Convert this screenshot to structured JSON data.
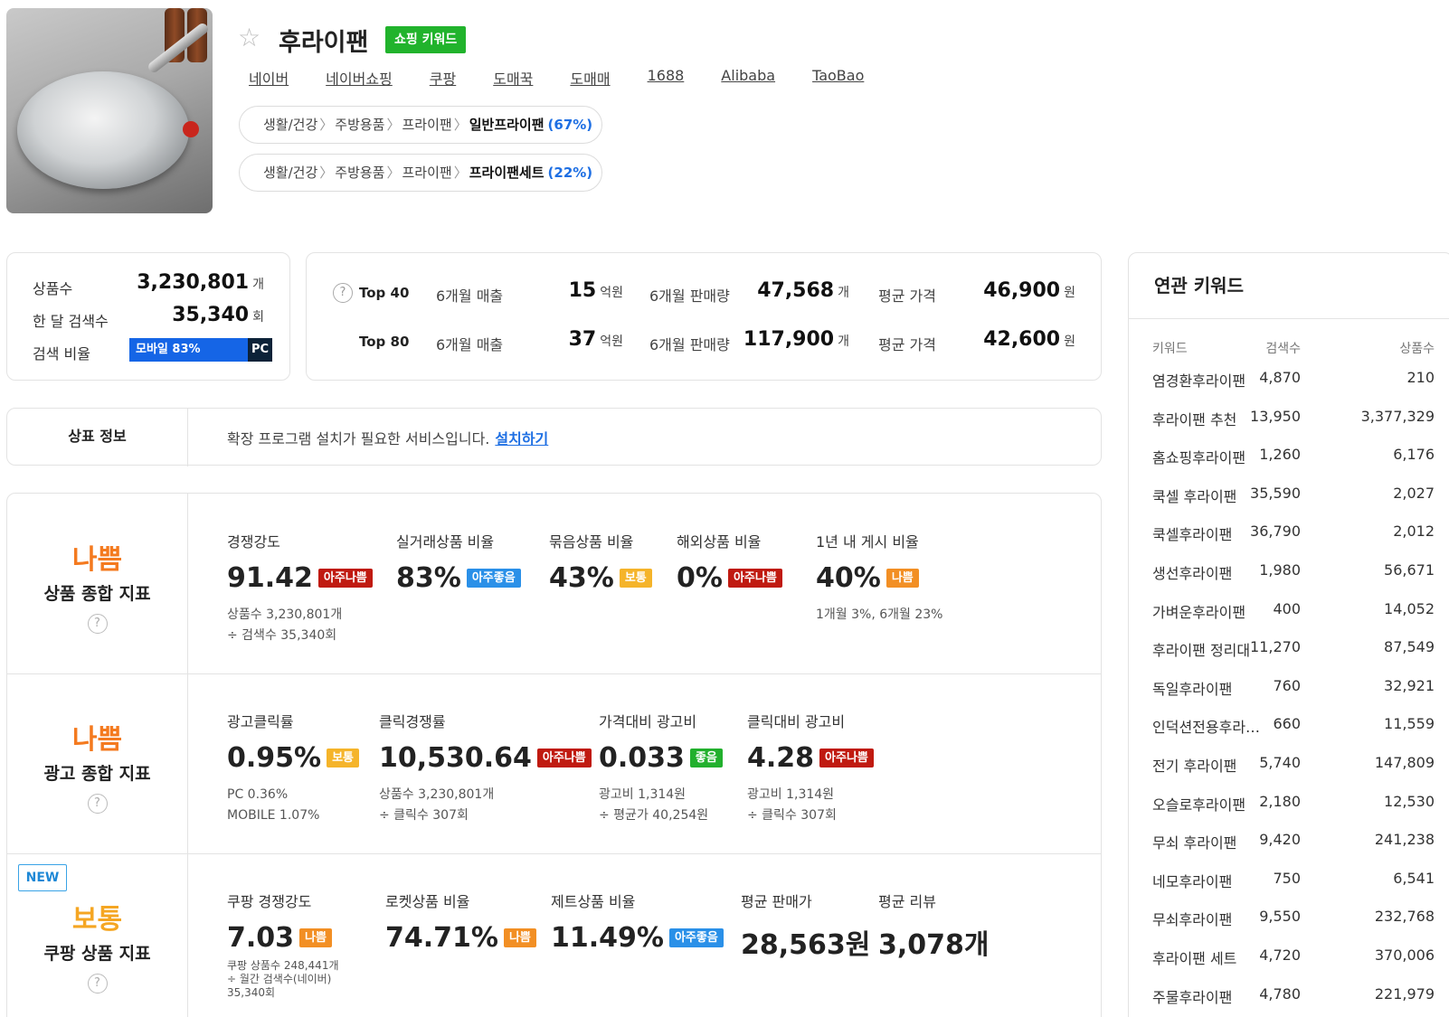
{
  "header": {
    "keyword": "후라이팬",
    "badge": "쇼핑 키워드",
    "links": [
      "네이버",
      "네이버쇼핑",
      "쿠팡",
      "도매꾹",
      "도매매",
      "1688",
      "Alibaba",
      "TaoBao"
    ],
    "categories": [
      {
        "path": [
          "생활/건강",
          "주방용품",
          "프라이팬"
        ],
        "leaf": "일반프라이팬",
        "pct": "(67%)"
      },
      {
        "path": [
          "생활/건강",
          "주방용품",
          "프라이팬"
        ],
        "leaf": "프라이팬세트",
        "pct": "(22%)"
      }
    ]
  },
  "summary": {
    "product_count_label": "상품수",
    "product_count": "3,230,801",
    "product_count_unit": "개",
    "monthly_search_label": "한 달 검색수",
    "monthly_search": "35,340",
    "monthly_search_unit": "회",
    "ratio_label": "검색 비율",
    "mobile": "모바일 83%",
    "pc": "PC 17%",
    "mobile_pct": 83,
    "pc_pct": 17
  },
  "top": {
    "help": "?",
    "rows": [
      {
        "label": "Top 40",
        "sales_label": "6개월 매출",
        "sales": "15",
        "sales_unit": "억원",
        "volume_label": "6개월 판매량",
        "volume": "47,568",
        "volume_unit": "개",
        "price_label": "평균 가격",
        "price": "46,900",
        "price_unit": "원"
      },
      {
        "label": "Top 80",
        "sales_label": "6개월 매출",
        "sales": "37",
        "sales_unit": "억원",
        "volume_label": "6개월 판매량",
        "volume": "117,900",
        "volume_unit": "개",
        "price_label": "평균 가격",
        "price": "42,600",
        "price_unit": "원"
      }
    ]
  },
  "trademark": {
    "label": "상표 정보",
    "text": "확장 프로그램 설치가 필요한 서비스입니다.",
    "install": "설치하기"
  },
  "indicators": {
    "product": {
      "grade": "나쁨",
      "name": "상품 종합 지표",
      "help": "?",
      "metrics": [
        {
          "label": "경쟁강도",
          "value": "91.42",
          "tag": "아주나쁨",
          "sub1": "상품수 3,230,801개",
          "sub2": "÷ 검색수 35,340회"
        },
        {
          "label": "실거래상품 비율",
          "value": "83%",
          "tag": "아주좋음",
          "sub1": "",
          "sub2": ""
        },
        {
          "label": "묶음상품 비율",
          "value": "43%",
          "tag": "보통",
          "sub1": "",
          "sub2": ""
        },
        {
          "label": "해외상품 비율",
          "value": "0%",
          "tag": "아주나쁨",
          "sub1": "",
          "sub2": ""
        },
        {
          "label": "1년 내 게시 비율",
          "value": "40%",
          "tag": "나쁨",
          "sub1": "1개월 3%, 6개월 23%",
          "sub2": ""
        }
      ]
    },
    "ad": {
      "grade": "나쁨",
      "name": "광고 종합 지표",
      "help": "?",
      "metrics": [
        {
          "label": "광고클릭률",
          "value": "0.95%",
          "tag": "보통",
          "sub1": "PC 0.36%",
          "sub2": "MOBILE 1.07%"
        },
        {
          "label": "클릭경쟁률",
          "value": "10,530.64",
          "tag": "아주나쁨",
          "sub1": "상품수 3,230,801개",
          "sub2": "÷ 클릭수 307회"
        },
        {
          "label": "가격대비 광고비",
          "value": "0.033",
          "tag": "좋음",
          "sub1": "광고비 1,314원",
          "sub2": "÷ 평균가 40,254원"
        },
        {
          "label": "클릭대비 광고비",
          "value": "4.28",
          "tag": "아주나쁨",
          "sub1": "광고비 1,314원",
          "sub2": "÷ 클릭수 307회"
        }
      ]
    },
    "coupang": {
      "new_badge": "NEW",
      "grade": "보통",
      "name": "쿠팡 상품 지표",
      "help": "?",
      "metrics": [
        {
          "label": "쿠팡 경쟁강도",
          "value": "7.03",
          "tag": "나쁨",
          "sub1": "쿠팡 상품수 248,441개",
          "sub2": "÷ 월간 검색수(네이버)",
          "sub3": "35,340회"
        },
        {
          "label": "로켓상품 비율",
          "value": "74.71%",
          "tag": "나쁨"
        },
        {
          "label": "제트상품 비율",
          "value": "11.49%",
          "tag": "아주좋음"
        },
        {
          "label": "평균 판매가",
          "value": "28,563원",
          "tag": ""
        },
        {
          "label": "평균 리뷰",
          "value": "3,078개",
          "tag": ""
        }
      ]
    }
  },
  "related": {
    "title": "연관 키워드",
    "columns": [
      "키워드",
      "검색수",
      "상품수"
    ],
    "rows": [
      [
        "염경환후라이팬",
        "4,870",
        "210"
      ],
      [
        "후라이팬 추천",
        "13,950",
        "3,377,329"
      ],
      [
        "홈쇼핑후라이팬",
        "1,260",
        "6,176"
      ],
      [
        "쿡셀 후라이팬",
        "35,590",
        "2,027"
      ],
      [
        "쿡셀후라이팬",
        "36,790",
        "2,012"
      ],
      [
        "생선후라이팬",
        "1,980",
        "56,671"
      ],
      [
        "가벼운후라이팬",
        "400",
        "14,052"
      ],
      [
        "후라이팬 정리대",
        "11,270",
        "87,549"
      ],
      [
        "독일후라이팬",
        "760",
        "32,921"
      ],
      [
        "인덕션전용후라…",
        "660",
        "11,559"
      ],
      [
        "전기 후라이팬",
        "5,740",
        "147,809"
      ],
      [
        "오슬로후라이팬",
        "2,180",
        "12,530"
      ],
      [
        "무쇠 후라이팬",
        "9,420",
        "241,238"
      ],
      [
        "네모후라이팬",
        "750",
        "6,541"
      ],
      [
        "무쇠후라이팬",
        "9,550",
        "232,768"
      ],
      [
        "후라이팬 세트",
        "4,720",
        "370,006"
      ],
      [
        "주물후라이팬",
        "4,780",
        "221,979"
      ]
    ]
  },
  "colors": {
    "accent_blue": "#1e6fe3",
    "shop_green": "#21b32c",
    "grade_bad": "#f47a1f",
    "grade_mid": "#f5a623",
    "tag_very_bad": "#c01a10",
    "tag_very_good": "#2a90e8",
    "tag_bad": "#f28f24",
    "tag_normal": "#f5b42a",
    "tag_good": "#22b02d"
  }
}
